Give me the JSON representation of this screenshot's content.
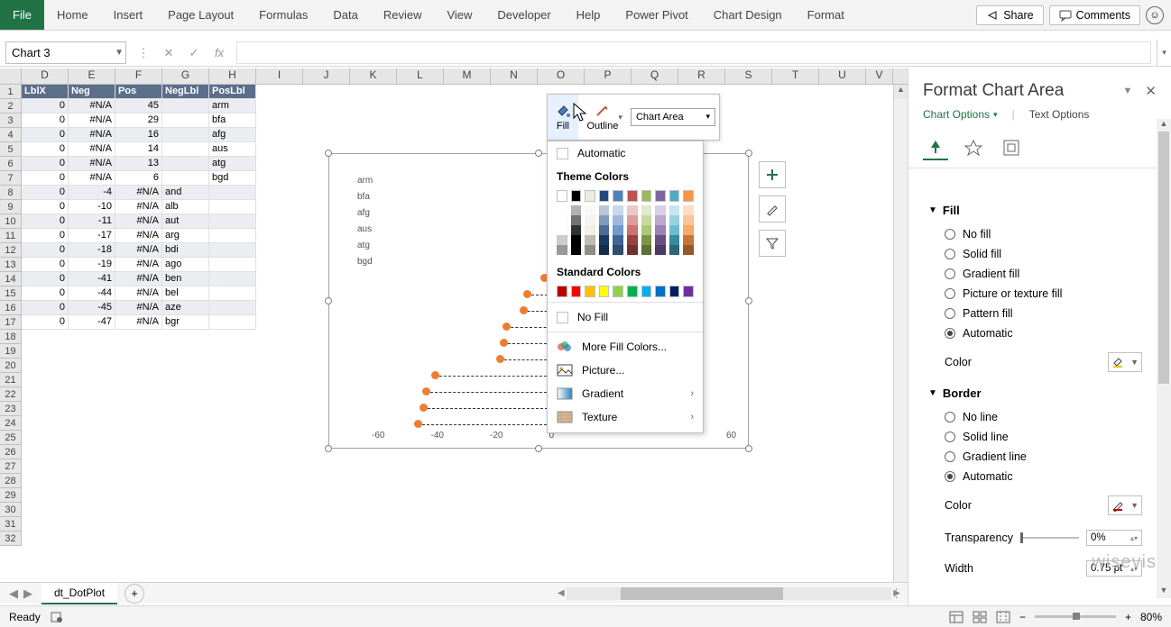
{
  "ribbon_tabs": [
    "File",
    "Home",
    "Insert",
    "Page Layout",
    "Formulas",
    "Data",
    "Review",
    "View",
    "Developer",
    "Help",
    "Power Pivot",
    "Chart Design",
    "Format"
  ],
  "ribbon_right": {
    "share": "Share",
    "comments": "Comments"
  },
  "name_box": "Chart 3",
  "grid": {
    "cols": [
      "D",
      "E",
      "F",
      "G",
      "H",
      "I",
      "J",
      "K",
      "L",
      "M",
      "N",
      "O",
      "P",
      "Q",
      "R",
      "S",
      "T",
      "U",
      "V"
    ],
    "header": [
      "LblX",
      "Neg",
      "Pos",
      "NegLbl",
      "PosLbl"
    ],
    "rows": [
      [
        "0",
        "#N/A",
        "45",
        "",
        "arm"
      ],
      [
        "0",
        "#N/A",
        "29",
        "",
        "bfa"
      ],
      [
        "0",
        "#N/A",
        "16",
        "",
        "afg"
      ],
      [
        "0",
        "#N/A",
        "14",
        "",
        "aus"
      ],
      [
        "0",
        "#N/A",
        "13",
        "",
        "atg"
      ],
      [
        "0",
        "#N/A",
        "6",
        "",
        "bgd"
      ],
      [
        "0",
        "-4",
        "#N/A",
        "and",
        ""
      ],
      [
        "0",
        "-10",
        "#N/A",
        "alb",
        ""
      ],
      [
        "0",
        "-11",
        "#N/A",
        "aut",
        ""
      ],
      [
        "0",
        "-17",
        "#N/A",
        "arg",
        ""
      ],
      [
        "0",
        "-18",
        "#N/A",
        "bdi",
        ""
      ],
      [
        "0",
        "-19",
        "#N/A",
        "ago",
        ""
      ],
      [
        "0",
        "-41",
        "#N/A",
        "ben",
        ""
      ],
      [
        "0",
        "-44",
        "#N/A",
        "bel",
        ""
      ],
      [
        "0",
        "-45",
        "#N/A",
        "aze",
        ""
      ],
      [
        "0",
        "-47",
        "#N/A",
        "bgr",
        ""
      ]
    ]
  },
  "chart_data": {
    "type": "dotplot",
    "y_labels": [
      "arm",
      "bfa",
      "afg",
      "aus",
      "atg",
      "bgd"
    ],
    "x_ticks": [
      -60,
      -40,
      -20,
      0,
      60
    ],
    "series": [
      {
        "name": "Pos",
        "values": [
          45,
          29,
          16,
          14,
          13,
          6
        ]
      },
      {
        "name": "Neg",
        "values": [
          -4,
          -10,
          -11,
          -17,
          -18,
          -19,
          -41,
          -44,
          -45,
          -47
        ]
      }
    ],
    "xlim": [
      -60,
      60
    ]
  },
  "mini_toolbar": {
    "fill": "Fill",
    "outline": "Outline",
    "selector": "Chart Area"
  },
  "color_dropdown": {
    "automatic": "Automatic",
    "theme_label": "Theme Colors",
    "standard_label": "Standard Colors",
    "no_fill": "No Fill",
    "more": "More Fill Colors...",
    "picture": "Picture...",
    "gradient": "Gradient",
    "texture": "Texture",
    "theme_colors": [
      "#ffffff",
      "#000000",
      "#eeece1",
      "#1f497d",
      "#4f81bd",
      "#c0504d",
      "#9bbb59",
      "#8064a2",
      "#4bacc6",
      "#f79646"
    ],
    "standard_colors": [
      "#c00000",
      "#ff0000",
      "#ffc000",
      "#ffff00",
      "#92d050",
      "#00b050",
      "#00b0f0",
      "#0070c0",
      "#002060",
      "#7030a0"
    ]
  },
  "format_pane": {
    "title": "Format Chart Area",
    "opt_chart": "Chart Options",
    "opt_text": "Text Options",
    "sec_fill": "Fill",
    "fill_radios": [
      "No fill",
      "Solid fill",
      "Gradient fill",
      "Picture or texture fill",
      "Pattern fill",
      "Automatic"
    ],
    "fill_selected": 5,
    "color_label": "Color",
    "sec_border": "Border",
    "border_radios": [
      "No line",
      "Solid line",
      "Gradient line",
      "Automatic"
    ],
    "border_selected": 3,
    "transparency_label": "Transparency",
    "transparency_value": "0%",
    "width_label": "Width",
    "width_value": "0.75 pt"
  },
  "sheet_tab": "dt_DotPlot",
  "status": {
    "ready": "Ready",
    "zoom": "80%"
  },
  "watermark": "wisevis"
}
